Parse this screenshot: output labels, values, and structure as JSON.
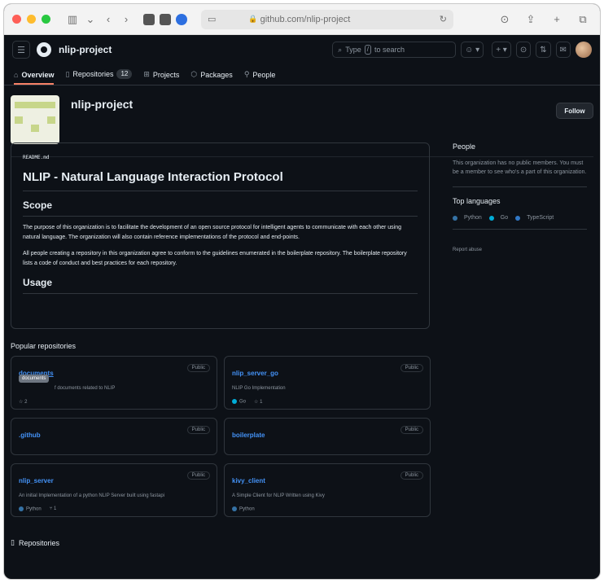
{
  "browser": {
    "url": "github.com/nlip-project"
  },
  "header": {
    "org": "nlip-project",
    "search_placeholder_pre": "Type",
    "search_slash": "/",
    "search_placeholder_post": "to search"
  },
  "nav": {
    "tabs": [
      {
        "label": "Overview",
        "icon": "book-icon"
      },
      {
        "label": "Repositories",
        "icon": "repo-icon",
        "count": "12"
      },
      {
        "label": "Projects",
        "icon": "table-icon"
      },
      {
        "label": "Packages",
        "icon": "package-icon"
      },
      {
        "label": "People",
        "icon": "person-icon"
      }
    ]
  },
  "org": {
    "title": "nlip-project",
    "follow_label": "Follow"
  },
  "readme": {
    "file": "README.md",
    "title": "NLIP - Natural Language Interaction Protocol",
    "scope_heading": "Scope",
    "para1": "The purpose of this organization is to facilitate the development of an open source protocol for intelligent agents to communicate with each other using natural language. The organization will also contain reference implementations of the protocol and end-points.",
    "para2": "All people creating a repository in this organization agree to conform to the guidelines enumerated in the boilerplate repository. The boilerplate repository lists a code of conduct and best practices for each repository.",
    "usage_heading": "Usage"
  },
  "popular": {
    "title": "Popular repositories",
    "tooltip": "documents",
    "repos": [
      {
        "name": "documents",
        "badge": "Public",
        "desc": "f documents related to NLIP",
        "stars": "2"
      },
      {
        "name": "nlip_server_go",
        "badge": "Public",
        "desc": "NLIP Go Implementation",
        "lang": "Go",
        "lang_color": "#00add8",
        "stars": "1"
      },
      {
        "name": ".github",
        "badge": "Public"
      },
      {
        "name": "boilerplate",
        "badge": "Public"
      },
      {
        "name": "nlip_server",
        "badge": "Public",
        "desc": "An initial Implementation of a python NLIP Server built using fastapi",
        "lang": "Python",
        "lang_color": "#3572a5",
        "forks": "1"
      },
      {
        "name": "kivy_client",
        "badge": "Public",
        "desc": "A Simple Client for NLIP Written using Kivy",
        "lang": "Python",
        "lang_color": "#3572a5"
      }
    ]
  },
  "repositories_footer": "Repositories",
  "sidebar": {
    "people_title": "People",
    "people_text": "This organization has no public members. You must be a member to see who's a part of this organization.",
    "languages_title": "Top languages",
    "languages": [
      {
        "name": "Python",
        "color": "#3572a5"
      },
      {
        "name": "Go",
        "color": "#00add8"
      },
      {
        "name": "TypeScript",
        "color": "#3178c6"
      }
    ],
    "report": "Report abuse"
  }
}
